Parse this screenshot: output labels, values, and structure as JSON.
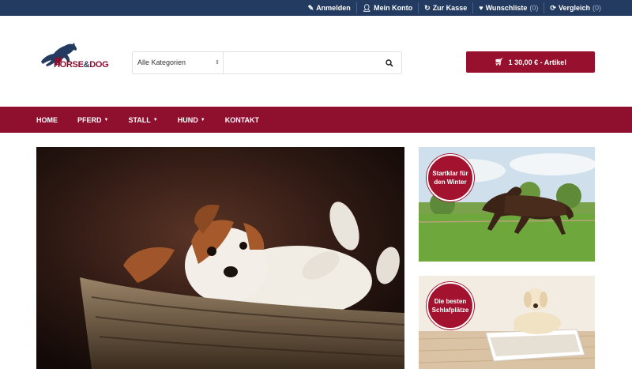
{
  "topnav": {
    "login": "Anmelden",
    "account": "Mein Konto",
    "checkout": "Zur Kasse",
    "wishlist": "Wunschliste",
    "wishlist_count": "(0)",
    "compare": "Vergleich",
    "compare_count": "(0)"
  },
  "logo": {
    "part1": "HORSE",
    "amp": "&",
    "part2": "DOG"
  },
  "search": {
    "category": "Alle Kategorien",
    "placeholder": ""
  },
  "cart": {
    "label": "1 30,00 € - Artikel"
  },
  "nav": [
    "HOME",
    "PFERD",
    "STALL",
    "HUND",
    "KONTAKT"
  ],
  "banners": {
    "winter": "Startklar für den Winter",
    "sleep": "Die besten Schlafplätze"
  },
  "colors": {
    "topbar": "#233b60",
    "brand": "#8f0f2e",
    "cart": "#97102e"
  }
}
